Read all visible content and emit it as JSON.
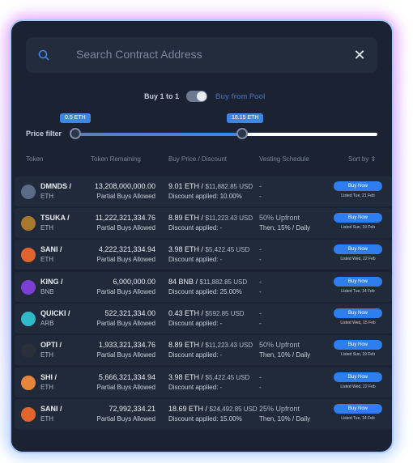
{
  "search": {
    "placeholder": "Search Contract Address"
  },
  "toggle": {
    "left_label": "Buy 1 to 1",
    "right_label": "Buy from Pool"
  },
  "price_filter": {
    "label": "Price filter",
    "min_value": "0.5 ETH",
    "max_value": "18.15 ETH"
  },
  "table": {
    "headers": [
      "Token",
      "Token Remaining",
      "Buy Price / Discount",
      "Vesting Schedule",
      "Sort by ⇕"
    ],
    "rows": [
      {
        "symbol": "DMNDS /",
        "chain": "ETH",
        "remaining": "13,208,000,000.00",
        "remaining_note": "Partial Buys Allowed",
        "price": "9.01 ETH /",
        "usd": "$11,882.85 USD",
        "discount": "Discount applied: 10.00%",
        "vesting": "-",
        "vesting2": "-",
        "buy": "Buy Now",
        "listed": "Listed Tue, 21 Feb",
        "logo_color": "#5a6b86"
      },
      {
        "symbol": "TSUKA /",
        "chain": "ETH",
        "remaining": "11,222,321,334.76",
        "remaining_note": "Partial Buys Allowed",
        "price": "8.89 ETH /",
        "usd": "$11,223.43 USD",
        "discount": "Discount applied: -",
        "vesting": "50% Upfront",
        "vesting2": "Then, 15% / Daily",
        "buy": "Buy Now",
        "listed": "Listed Sun, 19 Feb",
        "logo_color": "#a8782f"
      },
      {
        "symbol": "SANI /",
        "chain": "ETH",
        "remaining": "4,222,321,334.94",
        "remaining_note": "Partial Buys Allowed",
        "price": "3.98 ETH /",
        "usd": "$5,422.45 USD",
        "discount": "Discount applied: -",
        "vesting": "-",
        "vesting2": "-",
        "buy": "Buy Now",
        "listed": "Listed Wed, 22 Feb",
        "logo_color": "#e1642d"
      },
      {
        "symbol": "KING /",
        "chain": "BNB",
        "remaining": "6,000,000.00",
        "remaining_note": "Partial Buys Allowed",
        "price": "84 BNB /",
        "usd": "$11,882.85 USD",
        "discount": "Discount applied: 25.00%",
        "vesting": "-",
        "vesting2": "-",
        "buy": "Buy Now",
        "listed": "Listed Tue, 14 Feb",
        "logo_color": "#7c3fd6"
      },
      {
        "symbol": "QUICKI /",
        "chain": "ARB",
        "remaining": "522,321,334.00",
        "remaining_note": "Partial Buys Allowed",
        "price": "0.43 ETH /",
        "usd": "$592.85 USD",
        "discount": "Discount applied: -",
        "vesting": "-",
        "vesting2": "-",
        "buy": "Buy Now",
        "listed": "Listed Wed, 15 Feb",
        "logo_color": "#2fb9c9"
      },
      {
        "symbol": "OPTI /",
        "chain": "ETH",
        "remaining": "1,933,321,334.76",
        "remaining_note": "Partial Buys Allowed",
        "price": "8.89 ETH /",
        "usd": "$11,223.43 USD",
        "discount": "Discount applied: -",
        "vesting": "50% Upfront",
        "vesting2": "Then, 10% / Daily",
        "buy": "Buy Now",
        "listed": "Listed Sun, 19 Feb",
        "logo_color": "#2a2f3a"
      },
      {
        "symbol": "SHI /",
        "chain": "ETH",
        "remaining": "5,666,321,334.94",
        "remaining_note": "Partial Buys Allowed",
        "price": "3.98 ETH /",
        "usd": "$5,422.45 USD",
        "discount": "Discount applied: -",
        "vesting": "-",
        "vesting2": "-",
        "buy": "Buy Now",
        "listed": "Listed Wed, 22 Feb",
        "logo_color": "#e7863a"
      },
      {
        "symbol": "SANI /",
        "chain": "ETH",
        "remaining": "72,992,334.21",
        "remaining_note": "Partial Buys Allowed",
        "price": "18.69 ETH /",
        "usd": "$24,492.85 USD",
        "discount": "Discount applied: 15.00%",
        "vesting": "25% Upfront",
        "vesting2": "Then, 10% / Daily",
        "buy": "Buy Now",
        "listed": "Listed Tue, 14 Feb",
        "logo_color": "#e1642d"
      }
    ]
  },
  "colors": {
    "accent": "#2f7ef0",
    "panel": "#1b2333",
    "row": "#212a3a"
  }
}
